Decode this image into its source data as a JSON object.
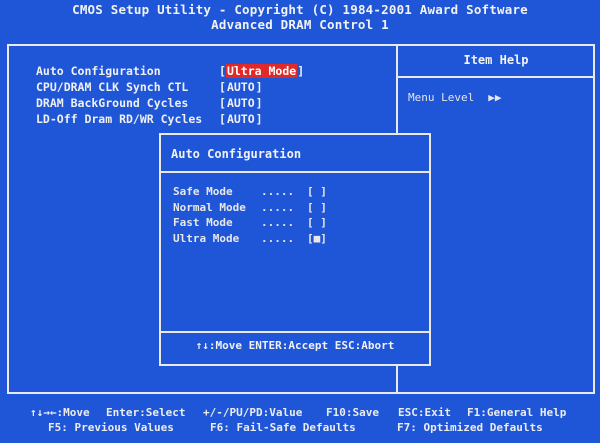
{
  "header": {
    "title": "CMOS Setup Utility - Copyright (C) 1984-2001 Award Software",
    "subtitle": "Advanced DRAM Control 1"
  },
  "settings": [
    {
      "label": "Auto Configuration",
      "value": "Ultra Mode",
      "selected": true
    },
    {
      "label": "CPU/DRAM CLK Synch CTL",
      "value": "AUTO",
      "selected": false
    },
    {
      "label": "DRAM BackGround Cycles",
      "value": "AUTO",
      "selected": false
    },
    {
      "label": "LD-Off Dram RD/WR Cycles",
      "value": "AUTO",
      "selected": false
    }
  ],
  "help": {
    "title": "Item Help",
    "menu_level_label": "Menu Level",
    "menu_level_arrow": "▶▶"
  },
  "dialog": {
    "title": "Auto Configuration",
    "options": [
      {
        "label": "Safe Mode",
        "dots": ".....",
        "mark": "[ ]"
      },
      {
        "label": "Normal Mode",
        "dots": ".....",
        "mark": "[ ]"
      },
      {
        "label": "Fast Mode",
        "dots": ".....",
        "mark": "[ ]"
      },
      {
        "label": "Ultra Mode",
        "dots": ".....",
        "mark": "[■]"
      }
    ],
    "hint": "↑↓:Move ENTER:Accept ESC:Abort"
  },
  "footer": {
    "row1": {
      "move": "↑↓→←:Move",
      "select": "Enter:Select",
      "value": "+/-/PU/PD:Value",
      "save": "F10:Save",
      "exit": "ESC:Exit",
      "help": "F1:General Help"
    },
    "row2": {
      "previous": "F5: Previous Values",
      "failsafe": "F6: Fail-Safe Defaults",
      "optimized": "F7: Optimized Defaults"
    }
  },
  "colors": {
    "background": "#1f56d8",
    "highlight": "#e02a2a",
    "frame": "#e9e9e9"
  }
}
